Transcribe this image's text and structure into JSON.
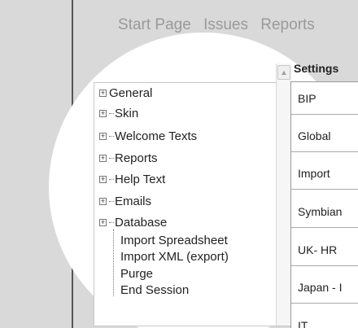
{
  "nav": {
    "items": [
      "Start Page",
      "Issues",
      "Reports"
    ]
  },
  "settings": {
    "title": "Settings",
    "rows": [
      "BIP",
      "Global",
      "Import",
      "Symbian",
      "UK- HR",
      "Japan - I",
      "IT"
    ]
  },
  "tree": {
    "general": "General",
    "skin": "Skin",
    "welcome": "Welcome Texts",
    "reports": "Reports",
    "help": "Help Text",
    "emails": "Emails",
    "database": "Database",
    "children": [
      "Import Spreadsheet",
      "Import XML (export)",
      "Purge",
      "End Session"
    ]
  },
  "icons": {
    "expand": "plus-box-icon",
    "scroll_up": "caret-up-icon"
  }
}
